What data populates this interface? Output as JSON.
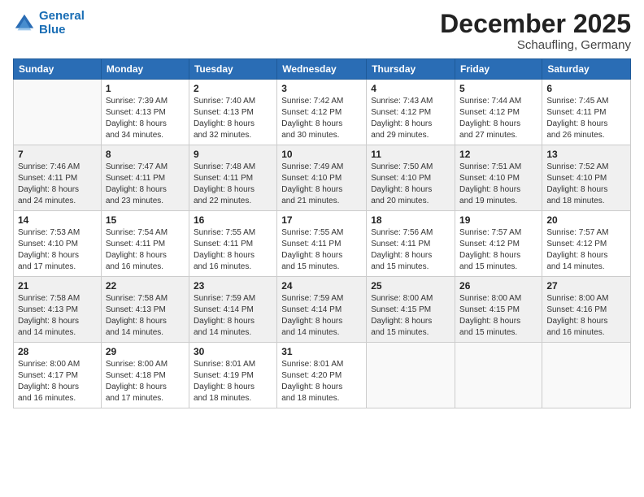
{
  "logo": {
    "line1": "General",
    "line2": "Blue"
  },
  "title": "December 2025",
  "location": "Schaufling, Germany",
  "days_header": [
    "Sunday",
    "Monday",
    "Tuesday",
    "Wednesday",
    "Thursday",
    "Friday",
    "Saturday"
  ],
  "weeks": [
    [
      {
        "num": "",
        "info": ""
      },
      {
        "num": "1",
        "info": "Sunrise: 7:39 AM\nSunset: 4:13 PM\nDaylight: 8 hours\nand 34 minutes."
      },
      {
        "num": "2",
        "info": "Sunrise: 7:40 AM\nSunset: 4:13 PM\nDaylight: 8 hours\nand 32 minutes."
      },
      {
        "num": "3",
        "info": "Sunrise: 7:42 AM\nSunset: 4:12 PM\nDaylight: 8 hours\nand 30 minutes."
      },
      {
        "num": "4",
        "info": "Sunrise: 7:43 AM\nSunset: 4:12 PM\nDaylight: 8 hours\nand 29 minutes."
      },
      {
        "num": "5",
        "info": "Sunrise: 7:44 AM\nSunset: 4:12 PM\nDaylight: 8 hours\nand 27 minutes."
      },
      {
        "num": "6",
        "info": "Sunrise: 7:45 AM\nSunset: 4:11 PM\nDaylight: 8 hours\nand 26 minutes."
      }
    ],
    [
      {
        "num": "7",
        "info": "Sunrise: 7:46 AM\nSunset: 4:11 PM\nDaylight: 8 hours\nand 24 minutes."
      },
      {
        "num": "8",
        "info": "Sunrise: 7:47 AM\nSunset: 4:11 PM\nDaylight: 8 hours\nand 23 minutes."
      },
      {
        "num": "9",
        "info": "Sunrise: 7:48 AM\nSunset: 4:11 PM\nDaylight: 8 hours\nand 22 minutes."
      },
      {
        "num": "10",
        "info": "Sunrise: 7:49 AM\nSunset: 4:10 PM\nDaylight: 8 hours\nand 21 minutes."
      },
      {
        "num": "11",
        "info": "Sunrise: 7:50 AM\nSunset: 4:10 PM\nDaylight: 8 hours\nand 20 minutes."
      },
      {
        "num": "12",
        "info": "Sunrise: 7:51 AM\nSunset: 4:10 PM\nDaylight: 8 hours\nand 19 minutes."
      },
      {
        "num": "13",
        "info": "Sunrise: 7:52 AM\nSunset: 4:10 PM\nDaylight: 8 hours\nand 18 minutes."
      }
    ],
    [
      {
        "num": "14",
        "info": "Sunrise: 7:53 AM\nSunset: 4:10 PM\nDaylight: 8 hours\nand 17 minutes."
      },
      {
        "num": "15",
        "info": "Sunrise: 7:54 AM\nSunset: 4:11 PM\nDaylight: 8 hours\nand 16 minutes."
      },
      {
        "num": "16",
        "info": "Sunrise: 7:55 AM\nSunset: 4:11 PM\nDaylight: 8 hours\nand 16 minutes."
      },
      {
        "num": "17",
        "info": "Sunrise: 7:55 AM\nSunset: 4:11 PM\nDaylight: 8 hours\nand 15 minutes."
      },
      {
        "num": "18",
        "info": "Sunrise: 7:56 AM\nSunset: 4:11 PM\nDaylight: 8 hours\nand 15 minutes."
      },
      {
        "num": "19",
        "info": "Sunrise: 7:57 AM\nSunset: 4:12 PM\nDaylight: 8 hours\nand 15 minutes."
      },
      {
        "num": "20",
        "info": "Sunrise: 7:57 AM\nSunset: 4:12 PM\nDaylight: 8 hours\nand 14 minutes."
      }
    ],
    [
      {
        "num": "21",
        "info": "Sunrise: 7:58 AM\nSunset: 4:13 PM\nDaylight: 8 hours\nand 14 minutes."
      },
      {
        "num": "22",
        "info": "Sunrise: 7:58 AM\nSunset: 4:13 PM\nDaylight: 8 hours\nand 14 minutes."
      },
      {
        "num": "23",
        "info": "Sunrise: 7:59 AM\nSunset: 4:14 PM\nDaylight: 8 hours\nand 14 minutes."
      },
      {
        "num": "24",
        "info": "Sunrise: 7:59 AM\nSunset: 4:14 PM\nDaylight: 8 hours\nand 14 minutes."
      },
      {
        "num": "25",
        "info": "Sunrise: 8:00 AM\nSunset: 4:15 PM\nDaylight: 8 hours\nand 15 minutes."
      },
      {
        "num": "26",
        "info": "Sunrise: 8:00 AM\nSunset: 4:15 PM\nDaylight: 8 hours\nand 15 minutes."
      },
      {
        "num": "27",
        "info": "Sunrise: 8:00 AM\nSunset: 4:16 PM\nDaylight: 8 hours\nand 16 minutes."
      }
    ],
    [
      {
        "num": "28",
        "info": "Sunrise: 8:00 AM\nSunset: 4:17 PM\nDaylight: 8 hours\nand 16 minutes."
      },
      {
        "num": "29",
        "info": "Sunrise: 8:00 AM\nSunset: 4:18 PM\nDaylight: 8 hours\nand 17 minutes."
      },
      {
        "num": "30",
        "info": "Sunrise: 8:01 AM\nSunset: 4:19 PM\nDaylight: 8 hours\nand 18 minutes."
      },
      {
        "num": "31",
        "info": "Sunrise: 8:01 AM\nSunset: 4:20 PM\nDaylight: 8 hours\nand 18 minutes."
      },
      {
        "num": "",
        "info": ""
      },
      {
        "num": "",
        "info": ""
      },
      {
        "num": "",
        "info": ""
      }
    ]
  ]
}
